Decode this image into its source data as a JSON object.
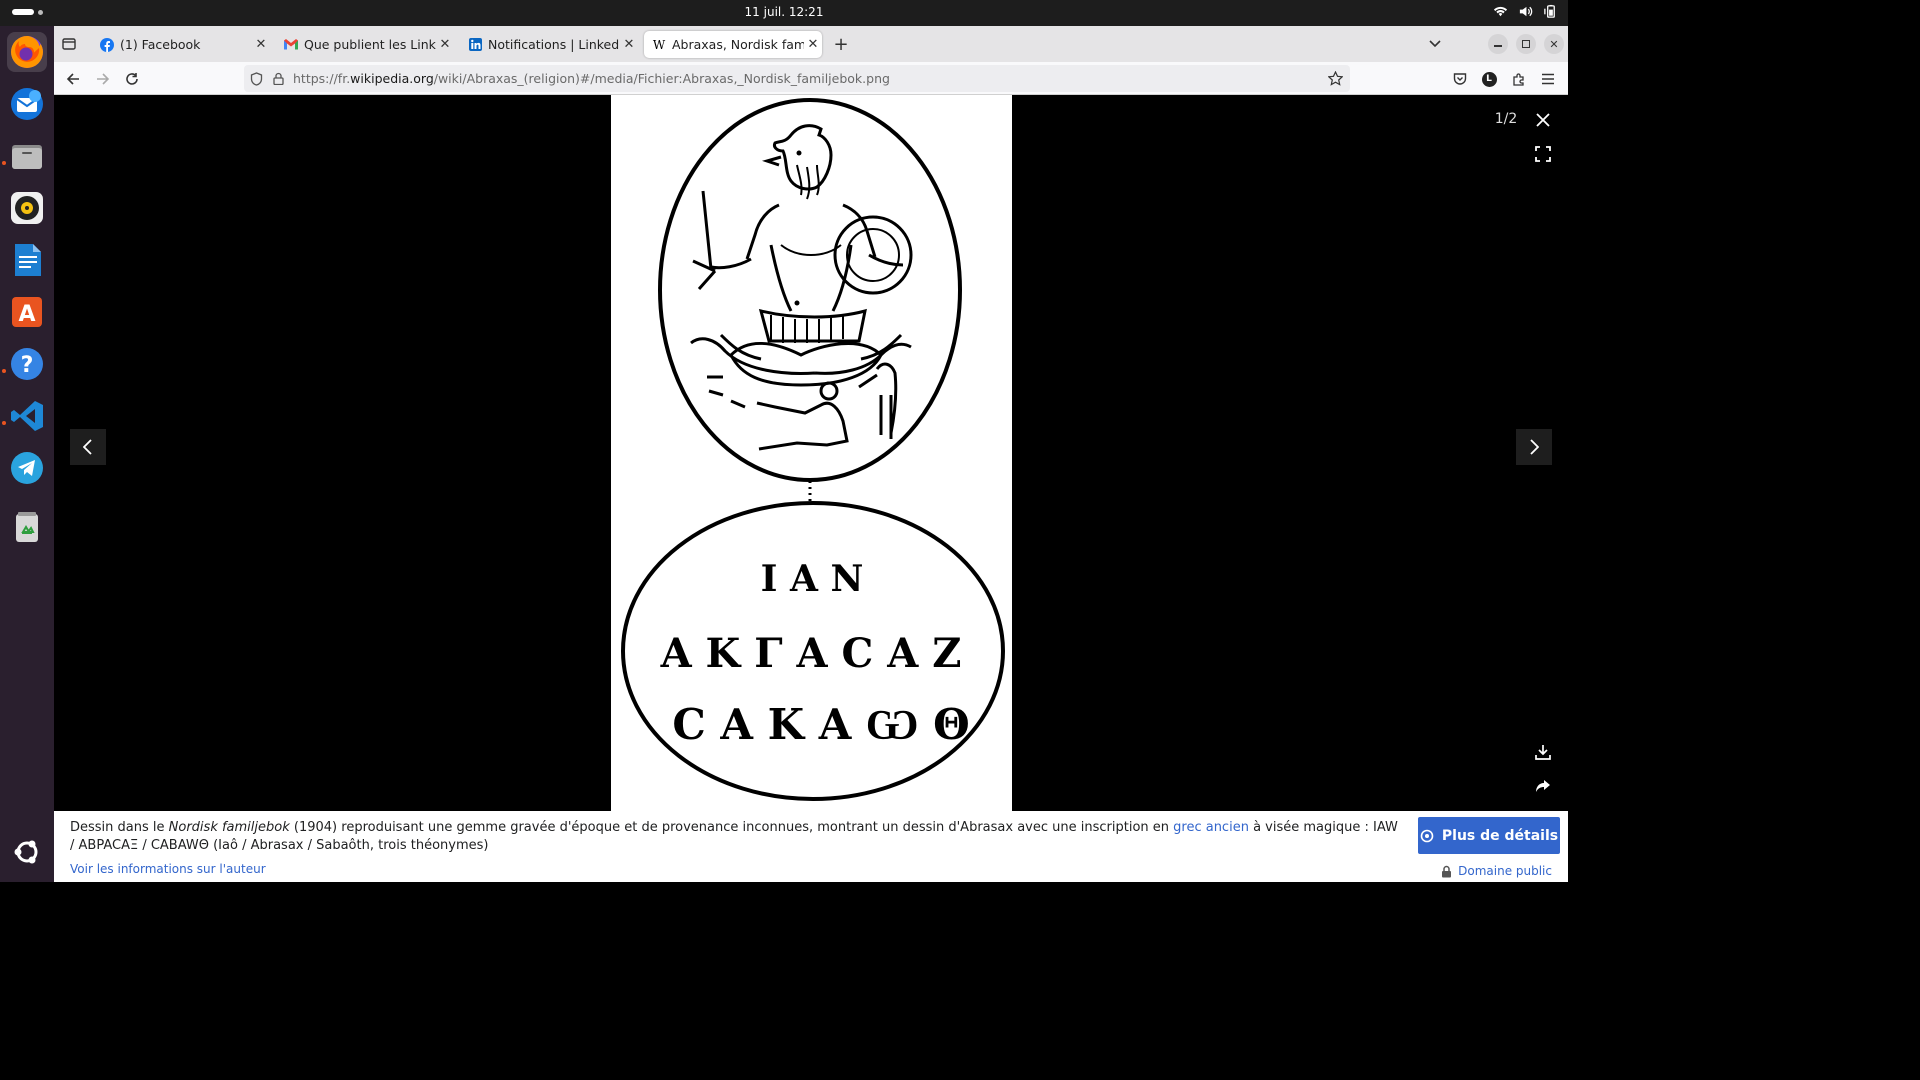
{
  "system": {
    "clock": "11 juil.  12:21",
    "tray_icons": [
      "wifi-icon",
      "volume-icon",
      "battery-icon"
    ]
  },
  "dock": {
    "apps": [
      {
        "name": "Firefox",
        "icon": "firefox-icon",
        "active": true
      },
      {
        "name": "Thunderbird",
        "icon": "thunderbird-icon"
      },
      {
        "name": "Files",
        "icon": "files-icon"
      },
      {
        "name": "Rhythmbox",
        "icon": "rhythmbox-icon"
      },
      {
        "name": "LibreOffice Writer",
        "icon": "writer-icon"
      },
      {
        "name": "App Center",
        "icon": "app-center-icon"
      },
      {
        "name": "Help",
        "icon": "help-icon"
      },
      {
        "name": "Visual Studio Code",
        "icon": "vscode-icon"
      },
      {
        "name": "Telegram",
        "icon": "telegram-icon"
      },
      {
        "name": "Trash",
        "icon": "trash-icon"
      }
    ]
  },
  "tabs": [
    {
      "title": "(1) Facebook",
      "icon": "facebook-icon"
    },
    {
      "title": "Que publient les LinkedIn",
      "icon": "gmail-icon"
    },
    {
      "title": "Notifications | LinkedIn",
      "icon": "linkedin-icon"
    },
    {
      "title": "Abraxas, Nordisk familjeb",
      "icon": "wikipedia-icon",
      "active": true
    }
  ],
  "url": {
    "prefix": "https://fr.",
    "domain": "wikipedia.org",
    "path": "/wiki/Abraxas_(religion)#/media/Fichier:Abraxas,_Nordisk_familjebok.png"
  },
  "viewer": {
    "counter": "1/2",
    "gem_lines": [
      "I A N",
      "A K Γ A C A Z",
      "C A K A Ѡ Θ"
    ]
  },
  "caption": {
    "desc_before": "Dessin dans le ",
    "desc_title": "Nordisk familjebok",
    "desc_mid": " (1904) reproduisant une gemme gravée d'époque et de provenance inconnues, montrant un dessin d'Abrasax avec une inscription en ",
    "desc_link": "grec ancien",
    "desc_after": " à visée magique : IAW / ABPACAΞ / CABAWΘ (Iaô / Abrasax / Sabaôth, trois théonymes)",
    "details_button": "Plus de détails",
    "author_link": "Voir les informations sur l'auteur",
    "license": "Domaine public"
  },
  "colors": {
    "accent": "#3366cc",
    "dock_bg": "#2a1f2e",
    "topbar_bg": "#1d1d1d",
    "dock_indicator": "#e95420"
  }
}
